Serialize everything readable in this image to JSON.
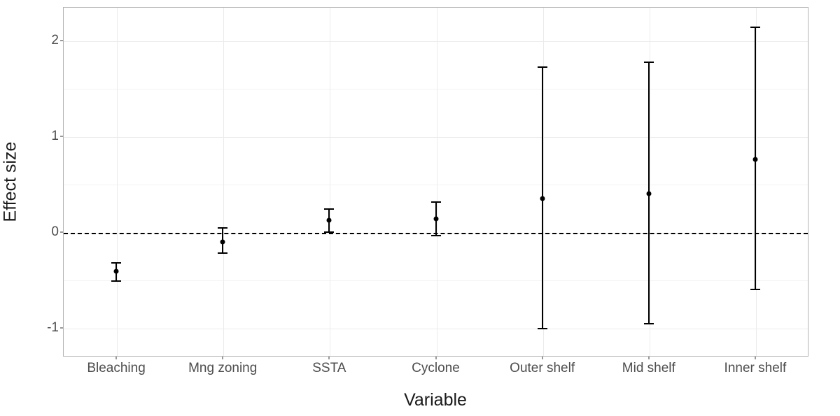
{
  "chart_data": {
    "type": "pointrange",
    "title": "",
    "xlabel": "Variable",
    "ylabel": "Effect size",
    "ylim": [
      -1.3,
      2.35
    ],
    "y_ticks": [
      -1,
      0,
      1,
      2
    ],
    "categories": [
      "Bleaching",
      "Mng zoning",
      "SSTA",
      "Cyclone",
      "Outer shelf",
      "Mid shelf",
      "Inner shelf"
    ],
    "series": [
      {
        "name": "Effect size",
        "points": [
          {
            "x": "Bleaching",
            "y": -0.41,
            "ymin": -0.51,
            "ymax": -0.32
          },
          {
            "x": "Mng zoning",
            "y": -0.1,
            "ymin": -0.22,
            "ymax": 0.04
          },
          {
            "x": "SSTA",
            "y": 0.12,
            "ymin": 0.0,
            "ymax": 0.24
          },
          {
            "x": "Cyclone",
            "y": 0.14,
            "ymin": -0.04,
            "ymax": 0.31
          },
          {
            "x": "Outer shelf",
            "y": 0.35,
            "ymin": -1.01,
            "ymax": 1.72
          },
          {
            "x": "Mid shelf",
            "y": 0.4,
            "ymin": -0.96,
            "ymax": 1.77
          },
          {
            "x": "Inner shelf",
            "y": 0.76,
            "ymin": -0.6,
            "ymax": 2.14
          }
        ]
      }
    ],
    "reference_line": 0
  }
}
